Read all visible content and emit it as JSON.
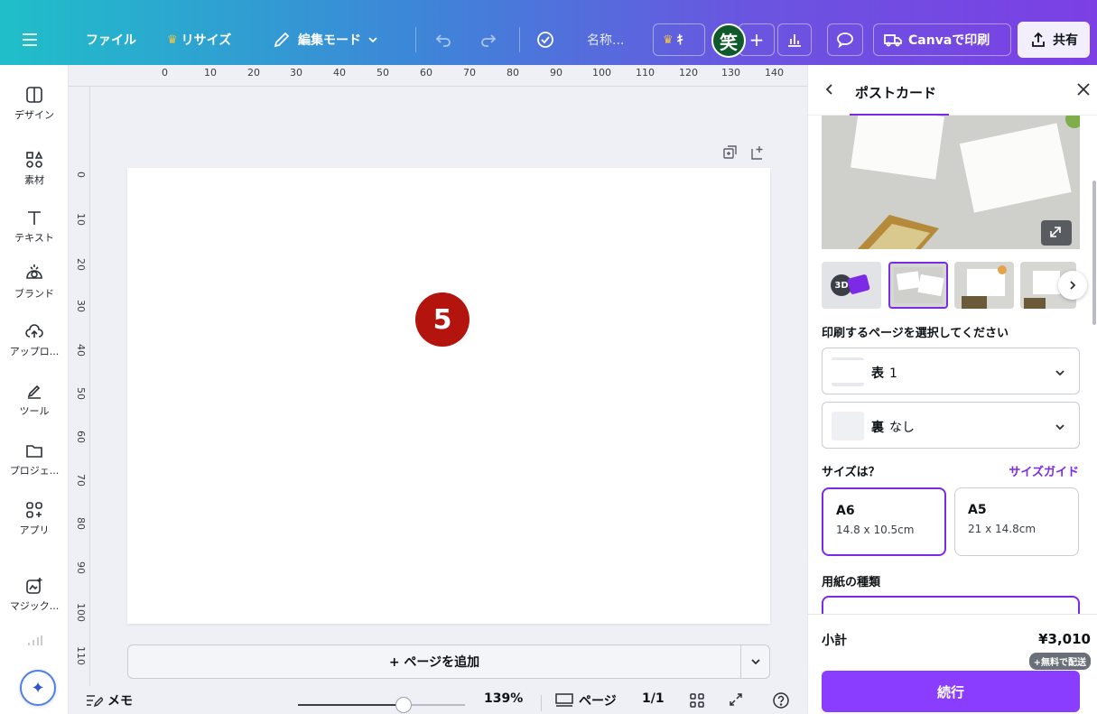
{
  "topbar": {
    "file": "ファイル",
    "resize": "リサイズ",
    "edit_mode": "編集モード",
    "doc_name": "名称...",
    "premium_short": "ｷ",
    "avatar_char": "笑",
    "print_btn": "Canvaで印刷",
    "share": "共有"
  },
  "sidebar": {
    "items": [
      {
        "label": "デザイン",
        "icon": "layout-icon"
      },
      {
        "label": "素材",
        "icon": "elements-icon"
      },
      {
        "label": "テキスト",
        "icon": "text-icon"
      },
      {
        "label": "ブランド",
        "icon": "brand-icon"
      },
      {
        "label": "アップロ...",
        "icon": "upload-icon"
      },
      {
        "label": "ツール",
        "icon": "draw-icon"
      },
      {
        "label": "プロジェ...",
        "icon": "folder-icon"
      },
      {
        "label": "アプリ",
        "icon": "apps-icon"
      },
      {
        "label": "マジック...",
        "icon": "magic-media-icon"
      }
    ]
  },
  "ruler": {
    "top": [
      "0",
      "10",
      "20",
      "30",
      "40",
      "50",
      "60",
      "70",
      "80",
      "90",
      "100",
      "110",
      "120",
      "130",
      "140"
    ],
    "left": [
      "0",
      "10",
      "20",
      "30",
      "40",
      "50",
      "60",
      "70",
      "80",
      "90",
      "100",
      "110"
    ]
  },
  "canvas": {
    "page_badge": "5",
    "add_page": "+ ページを追加"
  },
  "status": {
    "notes": "メモ",
    "zoom": "139%",
    "zoom_fraction": 0.63,
    "pages_label": "ページ",
    "page_count": "1/1"
  },
  "panel": {
    "title": "ポストカード",
    "thumb_3d_label": "3D",
    "select_pages_label": "印刷するページを選択してください",
    "front": {
      "side": "表",
      "value": "1"
    },
    "back": {
      "side": "裏",
      "value": "なし"
    },
    "size_question": "サイズは？",
    "size_guide": "サイズガイド",
    "sizes": [
      {
        "name": "A6",
        "dims": "14.8 x 10.5cm",
        "selected": true
      },
      {
        "name": "A5",
        "dims": "21 x 14.8cm",
        "selected": false
      }
    ],
    "paper_type": "用紙の種類",
    "subtotal_label": "小計",
    "subtotal_value": "¥3,010",
    "free_shipping": "+無料で配送",
    "continue": "続行"
  },
  "colors": {
    "accent": "#7d2ae8",
    "badge": "#b3140d",
    "avatar": "#0f5a2a"
  }
}
